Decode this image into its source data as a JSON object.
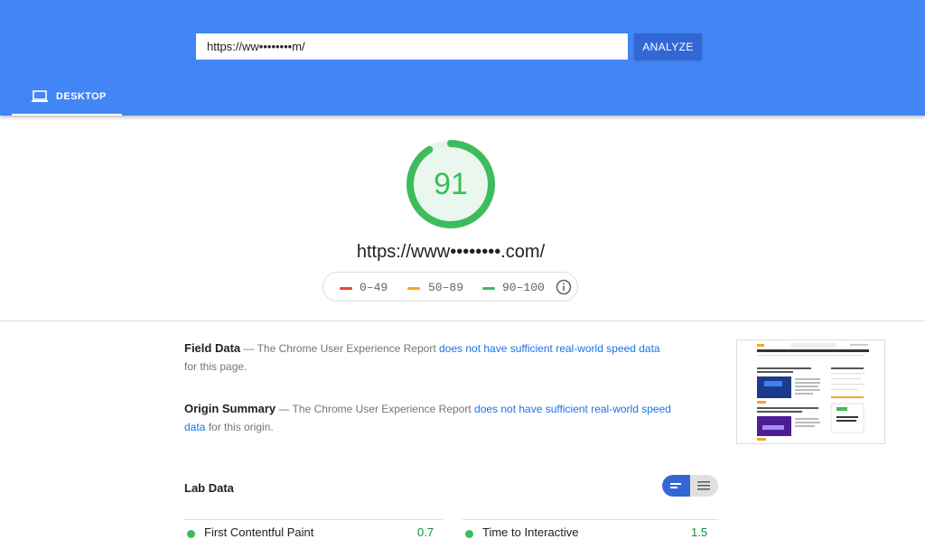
{
  "search": {
    "url_value": "https://ww••••••••m/",
    "analyze_label": "ANALYZE"
  },
  "tabs": [
    {
      "label": "DESKTOP",
      "icon": "laptop-icon",
      "active": true
    }
  ],
  "score": {
    "value": "91",
    "tested_url": "https://www••••••••.com/"
  },
  "legend": {
    "items": [
      {
        "label": "0–49",
        "color": "#ea4335"
      },
      {
        "label": "50–89",
        "color": "#f5a623"
      },
      {
        "label": "90–100",
        "color": "#3dbc5c"
      }
    ]
  },
  "field_data": {
    "title": "Field Data",
    "pre": " — The Chrome User Experience Report ",
    "link": "does not have sufficient real-world speed data",
    "post": " for this page."
  },
  "origin_summary": {
    "title": "Origin Summary",
    "pre": " — The Chrome User Experience Report ",
    "link": "does not have sufficient real-world speed data",
    "post": " for this origin."
  },
  "lab_data": {
    "title": "Lab Data",
    "metrics": [
      {
        "label": "First Contentful Paint",
        "value": "0.7"
      },
      {
        "label": "Time to Interactive",
        "value": "1.5"
      }
    ]
  },
  "colors": {
    "header": "#4285f4",
    "button": "#3367d6",
    "pass": "#3dbc5c",
    "link": "#1a73e8"
  }
}
